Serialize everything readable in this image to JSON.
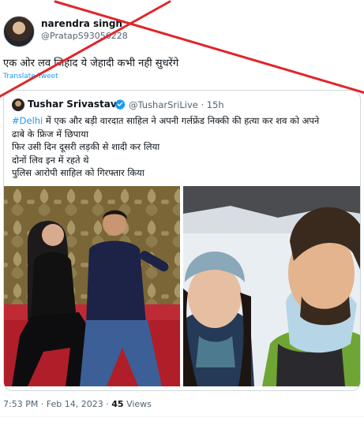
{
  "tweet": {
    "author_name": "narendra singh",
    "author_handle": "@PratapS93056228",
    "text": "एक ओर लव जिहाद ये जेहादी कभी नही सुधरेंगे",
    "translate_label": "Translate Tweet",
    "timestamp": "7:53 PM · Feb 14, 2023 · ",
    "views_count": "45",
    "views_label": " Views"
  },
  "quoted_tweet": {
    "author_name": "Tushar Srivastava",
    "author_handle": "@TusharSriLive · 15h",
    "hashtag": "#Delhi",
    "line1_rest": " में एक और बड़ी वारदात साहिल ने अपनी गर्लफ्रेंड निक्की की हत्या कर शव को अपने",
    "line2": "ढाबे के फ्रिज में छिपाया",
    "line3": "फिर उसी दिन दूसरी लड़की से शादी कर लिया",
    "line4": "दोनों लिव इन में रहते थे",
    "line5": "पुलिस आरोपी साहिल को गिरफ्तार किया"
  },
  "colors": {
    "link_blue": "#1d9bf0",
    "cross_red": "#e0252b",
    "secondary_text": "#536471",
    "verified_blue": "#1d9bf0"
  },
  "icons": {
    "verified": "verified-badge-icon",
    "overlay": "red-cross-overlay"
  }
}
